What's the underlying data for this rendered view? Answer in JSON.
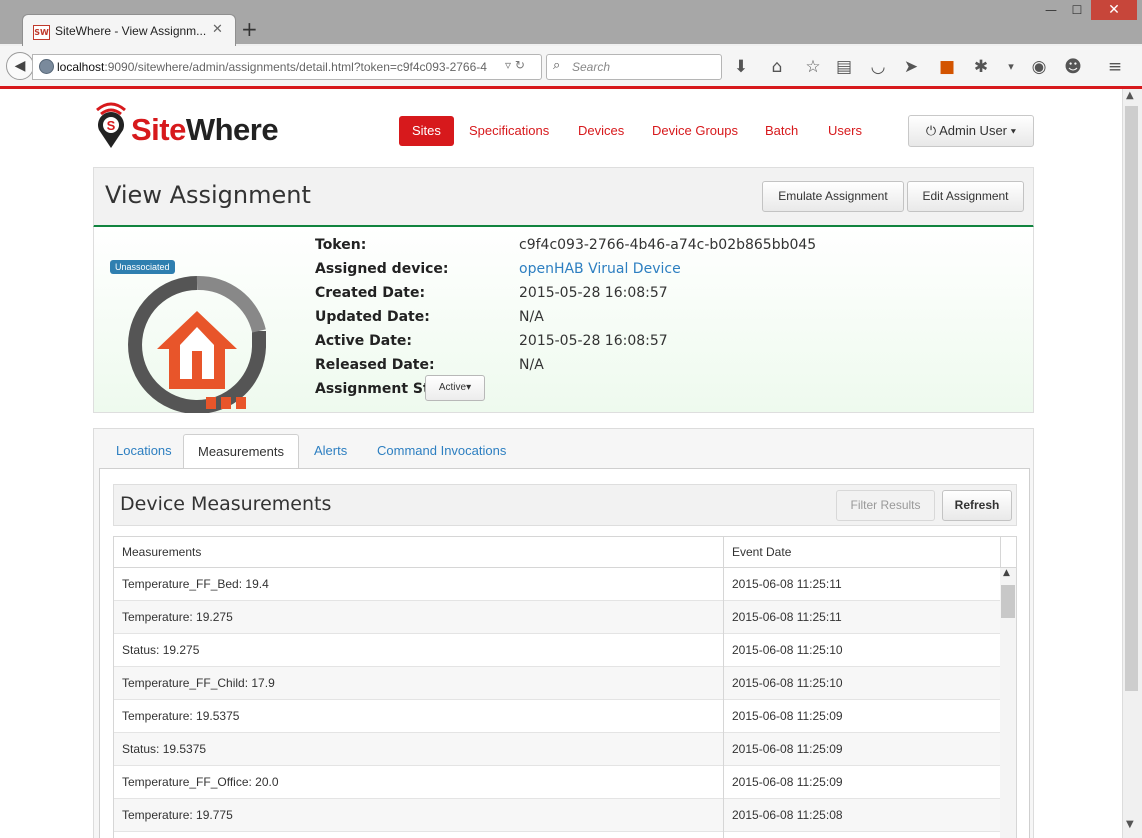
{
  "browser": {
    "tab_title": "SiteWhere - View Assignm...",
    "favicon": "SW",
    "url_host": "localhost",
    "url_rest": ":9090/sitewhere/admin/assignments/detail.html?token=c9f4c093-2766-4",
    "search_placeholder": "Search"
  },
  "site": {
    "logo_text_a": "Site",
    "logo_text_b": "Where",
    "nav": [
      "Sites",
      "Specifications",
      "Devices",
      "Device Groups",
      "Batch",
      "Users"
    ],
    "user_menu": "Admin User"
  },
  "header": {
    "title": "View Assignment",
    "emulate_label": "Emulate Assignment",
    "edit_label": "Edit Assignment"
  },
  "assignment": {
    "badge": "Unassociated",
    "labels": {
      "token": "Token:",
      "device": "Assigned device:",
      "created": "Created Date:",
      "updated": "Updated Date:",
      "active": "Active Date:",
      "released": "Released Date:",
      "status": "Assignment Status:"
    },
    "token": "c9f4c093-2766-4b46-a74c-b02b865bb045",
    "device": "openHAB Virual Device",
    "created": "2015-05-28 16:08:57",
    "updated": "N/A",
    "active": "2015-05-28 16:08:57",
    "released": "N/A",
    "status": "Active"
  },
  "tabs": [
    "Locations",
    "Measurements",
    "Alerts",
    "Command Invocations"
  ],
  "measurements": {
    "title": "Device Measurements",
    "filter_label": "Filter Results",
    "refresh_label": "Refresh",
    "columns": [
      "Measurements",
      "Event Date"
    ],
    "rows": [
      [
        "Temperature_FF_Bed: 19.4",
        "2015-06-08 11:25:11"
      ],
      [
        "Temperature: 19.275",
        "2015-06-08 11:25:11"
      ],
      [
        "Status: 19.275",
        "2015-06-08 11:25:10"
      ],
      [
        "Temperature_FF_Child: 17.9",
        "2015-06-08 11:25:10"
      ],
      [
        "Temperature: 19.5375",
        "2015-06-08 11:25:09"
      ],
      [
        "Status: 19.5375",
        "2015-06-08 11:25:09"
      ],
      [
        "Temperature_FF_Office: 20.0",
        "2015-06-08 11:25:09"
      ],
      [
        "Temperature: 19.775",
        "2015-06-08 11:25:08"
      ]
    ]
  },
  "colors": {
    "brand_red": "#d7191c",
    "header_green": "#11843f",
    "link_blue": "#2d7fc1"
  }
}
